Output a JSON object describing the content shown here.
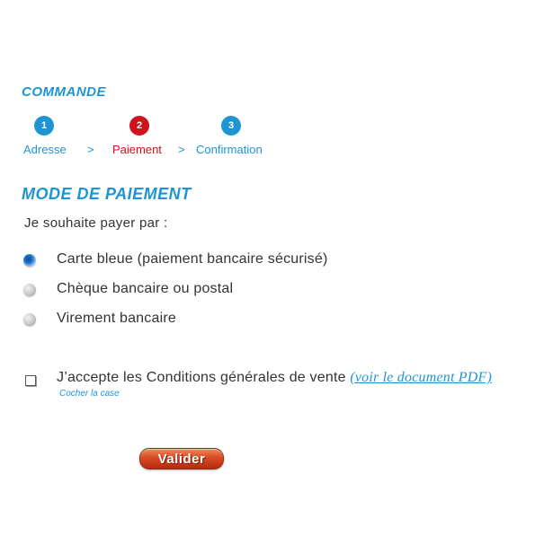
{
  "order": {
    "title": "COMMANDE",
    "steps": [
      {
        "number": "1",
        "label": "Adresse",
        "state": "done"
      },
      {
        "number": "2",
        "label": "Paiement",
        "state": "current"
      },
      {
        "number": "3",
        "label": "Confirmation",
        "state": "todo"
      }
    ],
    "separator": ">"
  },
  "payment": {
    "title": "MODE DE PAIEMENT",
    "intro": "Je souhaite payer par :",
    "options": [
      {
        "label": "Carte bleue (paiement bancaire sécurisé)",
        "selected": true
      },
      {
        "label": "Chèque bancaire ou postal",
        "selected": false
      },
      {
        "label": "Virement bancaire",
        "selected": false
      }
    ]
  },
  "terms": {
    "label": "J’accepte les Conditions générales de vente",
    "link_text": "(voir le document PDF)",
    "hint": "Cocher la case",
    "checked": false
  },
  "actions": {
    "submit_label": "Valider"
  },
  "colors": {
    "accent": "#1e95d2",
    "current_step": "#d0121c",
    "button": "#d94a25"
  }
}
